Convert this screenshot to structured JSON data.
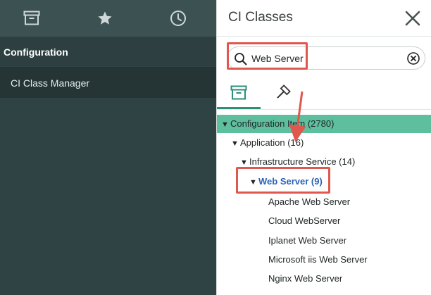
{
  "nav": {
    "tabs": [
      {
        "icon": "archive-icon"
      },
      {
        "icon": "star-icon"
      },
      {
        "icon": "clock-icon"
      }
    ],
    "section_label": "Configuration",
    "module_label": "CI Class Manager"
  },
  "panel": {
    "title": "CI Classes",
    "search": {
      "value": "Web Server"
    },
    "tabs": [
      {
        "icon": "archive-icon",
        "active": true
      },
      {
        "icon": "hammer-icon",
        "active": false
      }
    ],
    "tree": {
      "root": "Configuration Item (2780)",
      "level1": "Application (16)",
      "level2": "Infrastructure Service (14)",
      "selected": "Web Server (9)",
      "leaves": [
        "Apache Web Server",
        "Cloud WebServer",
        "Iplanet Web Server",
        "Microsoft iis Web Server",
        "Nginx Web Server"
      ]
    }
  },
  "colors": {
    "nav_bg": "#2f4344",
    "accent": "#5ebf9f",
    "highlight_red": "#e0574d",
    "link_blue": "#2a63b8"
  }
}
